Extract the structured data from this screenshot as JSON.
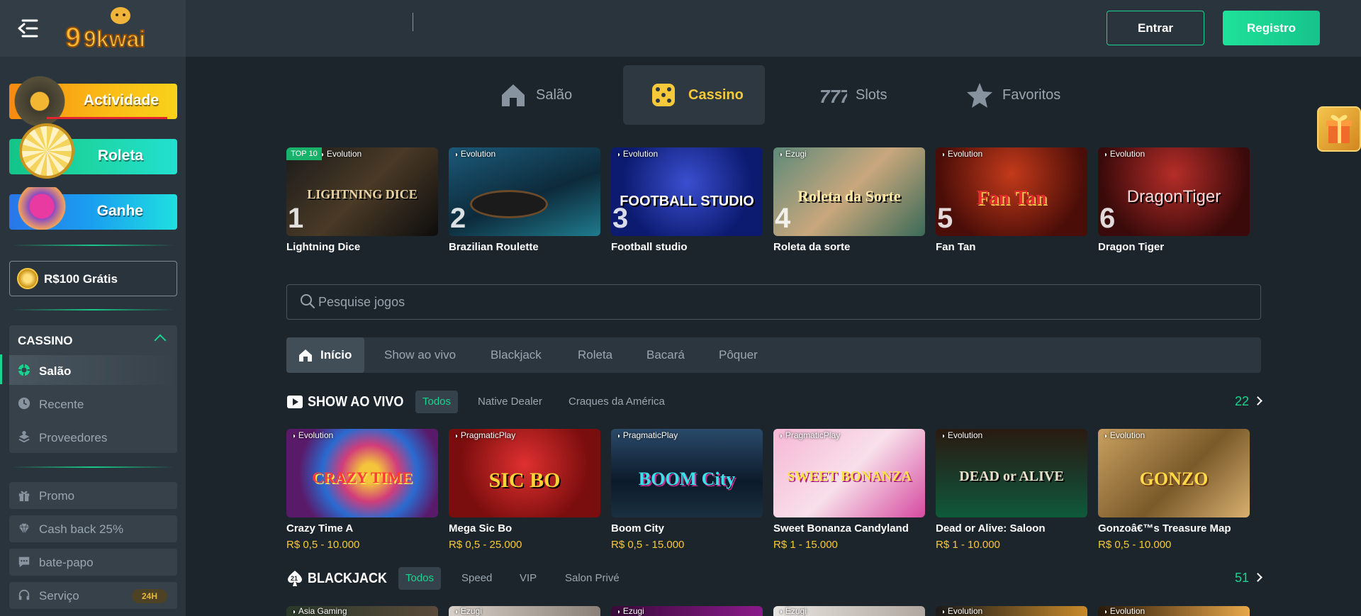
{
  "brand": {
    "logo_text": "9kwai"
  },
  "header": {
    "login_label": "Entrar",
    "register_label": "Registro"
  },
  "sidebar": {
    "promos": [
      {
        "label": "Actividade"
      },
      {
        "label": "Roleta"
      },
      {
        "label": "Ganhe"
      }
    ],
    "bonus_label": "R$100 Grátis",
    "cassino": {
      "title": "CASSINO",
      "items": [
        {
          "label": "Salão"
        },
        {
          "label": "Recente"
        },
        {
          "label": "Proveedores"
        }
      ]
    },
    "buttons": [
      {
        "label": "Promo"
      },
      {
        "label": "Cash back 25%"
      },
      {
        "label": "bate-papo"
      },
      {
        "label": "Serviço",
        "badge": "24H"
      }
    ]
  },
  "main_tabs": [
    {
      "label": "Salão",
      "icon": "home-icon"
    },
    {
      "label": "Cassino",
      "icon": "dice-icon",
      "active": true
    },
    {
      "label": "Slots",
      "icon": "777-icon"
    },
    {
      "label": "Favoritos",
      "icon": "star-icon"
    }
  ],
  "top_games": {
    "badge": "TOP 10",
    "items": [
      {
        "rank": "1",
        "provider": "Evolution",
        "name": "Lightning Dice",
        "art": "LIGHTNING DICE"
      },
      {
        "rank": "2",
        "provider": "Evolution",
        "name": "Brazilian Roulette",
        "art": ""
      },
      {
        "rank": "3",
        "provider": "Evolution",
        "name": "Football studio",
        "art": "FOOTBALL STUDIO"
      },
      {
        "rank": "4",
        "provider": "Ezugi",
        "name": "Roleta da sorte",
        "art": "Roleta da Sorte"
      },
      {
        "rank": "5",
        "provider": "Evolution",
        "name": "Fan Tan",
        "art": "Fan Tan"
      },
      {
        "rank": "6",
        "provider": "Evolution",
        "name": "Dragon Tiger",
        "art": "DragonTiger"
      }
    ]
  },
  "search": {
    "placeholder": "Pesquise jogos"
  },
  "categories": [
    "Início",
    "Show ao vivo",
    "Blackjack",
    "Roleta",
    "Bacará",
    "Pôquer"
  ],
  "show_ao_vivo": {
    "title": "SHOW AO VIVO",
    "filters": [
      "Todos",
      "Native Dealer",
      "Craques da América"
    ],
    "count": "22",
    "games": [
      {
        "provider": "Evolution",
        "name": "Crazy Time A",
        "price": "R$ 0,5 - 10.000",
        "art": "CRAZY TIME"
      },
      {
        "provider": "PragmaticPlay",
        "name": "Mega Sic Bo",
        "price": "R$ 0,5 - 25.000",
        "art": "SIC BO"
      },
      {
        "provider": "PragmaticPlay",
        "name": "Boom City",
        "price": "R$ 0,5 - 15.000",
        "art": "BOOM City"
      },
      {
        "provider": "PragmaticPlay",
        "name": "Sweet Bonanza Candyland",
        "price": "R$ 1 - 15.000",
        "art": "SWEET BONANZA"
      },
      {
        "provider": "Evolution",
        "name": "Dead or Alive: Saloon",
        "price": "R$ 1 - 10.000",
        "art": "DEAD or ALIVE"
      },
      {
        "provider": "Evolution",
        "name": "Gonzoâ€™s Treasure Map",
        "price": "R$ 0,5 - 10.000",
        "art": "GONZO"
      }
    ]
  },
  "blackjack": {
    "title": "BLACKJACK",
    "filters": [
      "Todos",
      "Speed",
      "VIP",
      "Salon Privé"
    ],
    "count": "51",
    "providers": [
      "Asia Gaming",
      "Ezugi",
      "Ezugi",
      "Ezugi",
      "Evolution",
      "Evolution"
    ]
  },
  "colors": {
    "accent": "#19d38e",
    "gold": "#f6c93a",
    "bg": "#1d252c",
    "panel": "#2a343c"
  }
}
